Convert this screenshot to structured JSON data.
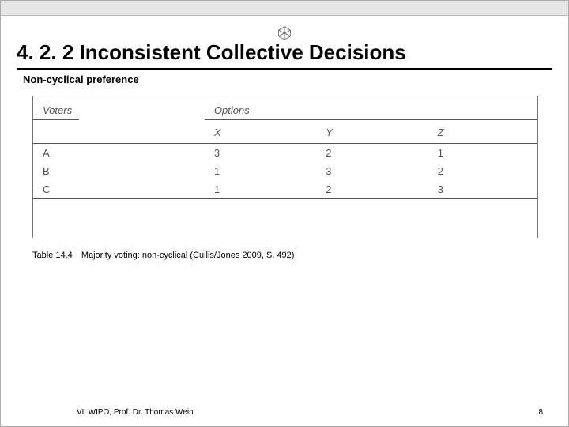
{
  "heading": "4. 2. 2 Inconsistent Collective Decisions",
  "subtitle": "Non-cyclical preference",
  "table": {
    "col_voters": "Voters",
    "col_options": "Options",
    "options": {
      "x": "X",
      "y": "Y",
      "z": "Z"
    },
    "rows": [
      {
        "voter": "A",
        "x": "3",
        "y": "2",
        "z": "1"
      },
      {
        "voter": "B",
        "x": "1",
        "y": "3",
        "z": "2"
      },
      {
        "voter": "C",
        "x": "1",
        "y": "2",
        "z": "3"
      }
    ]
  },
  "caption": {
    "label": "Table 14.4",
    "text": "Majority voting: non-cyclical (Cullis/Jones 2009, S. 492)"
  },
  "footer": {
    "left": "VL WIPO, Prof. Dr. Thomas Wein",
    "right": "8"
  }
}
